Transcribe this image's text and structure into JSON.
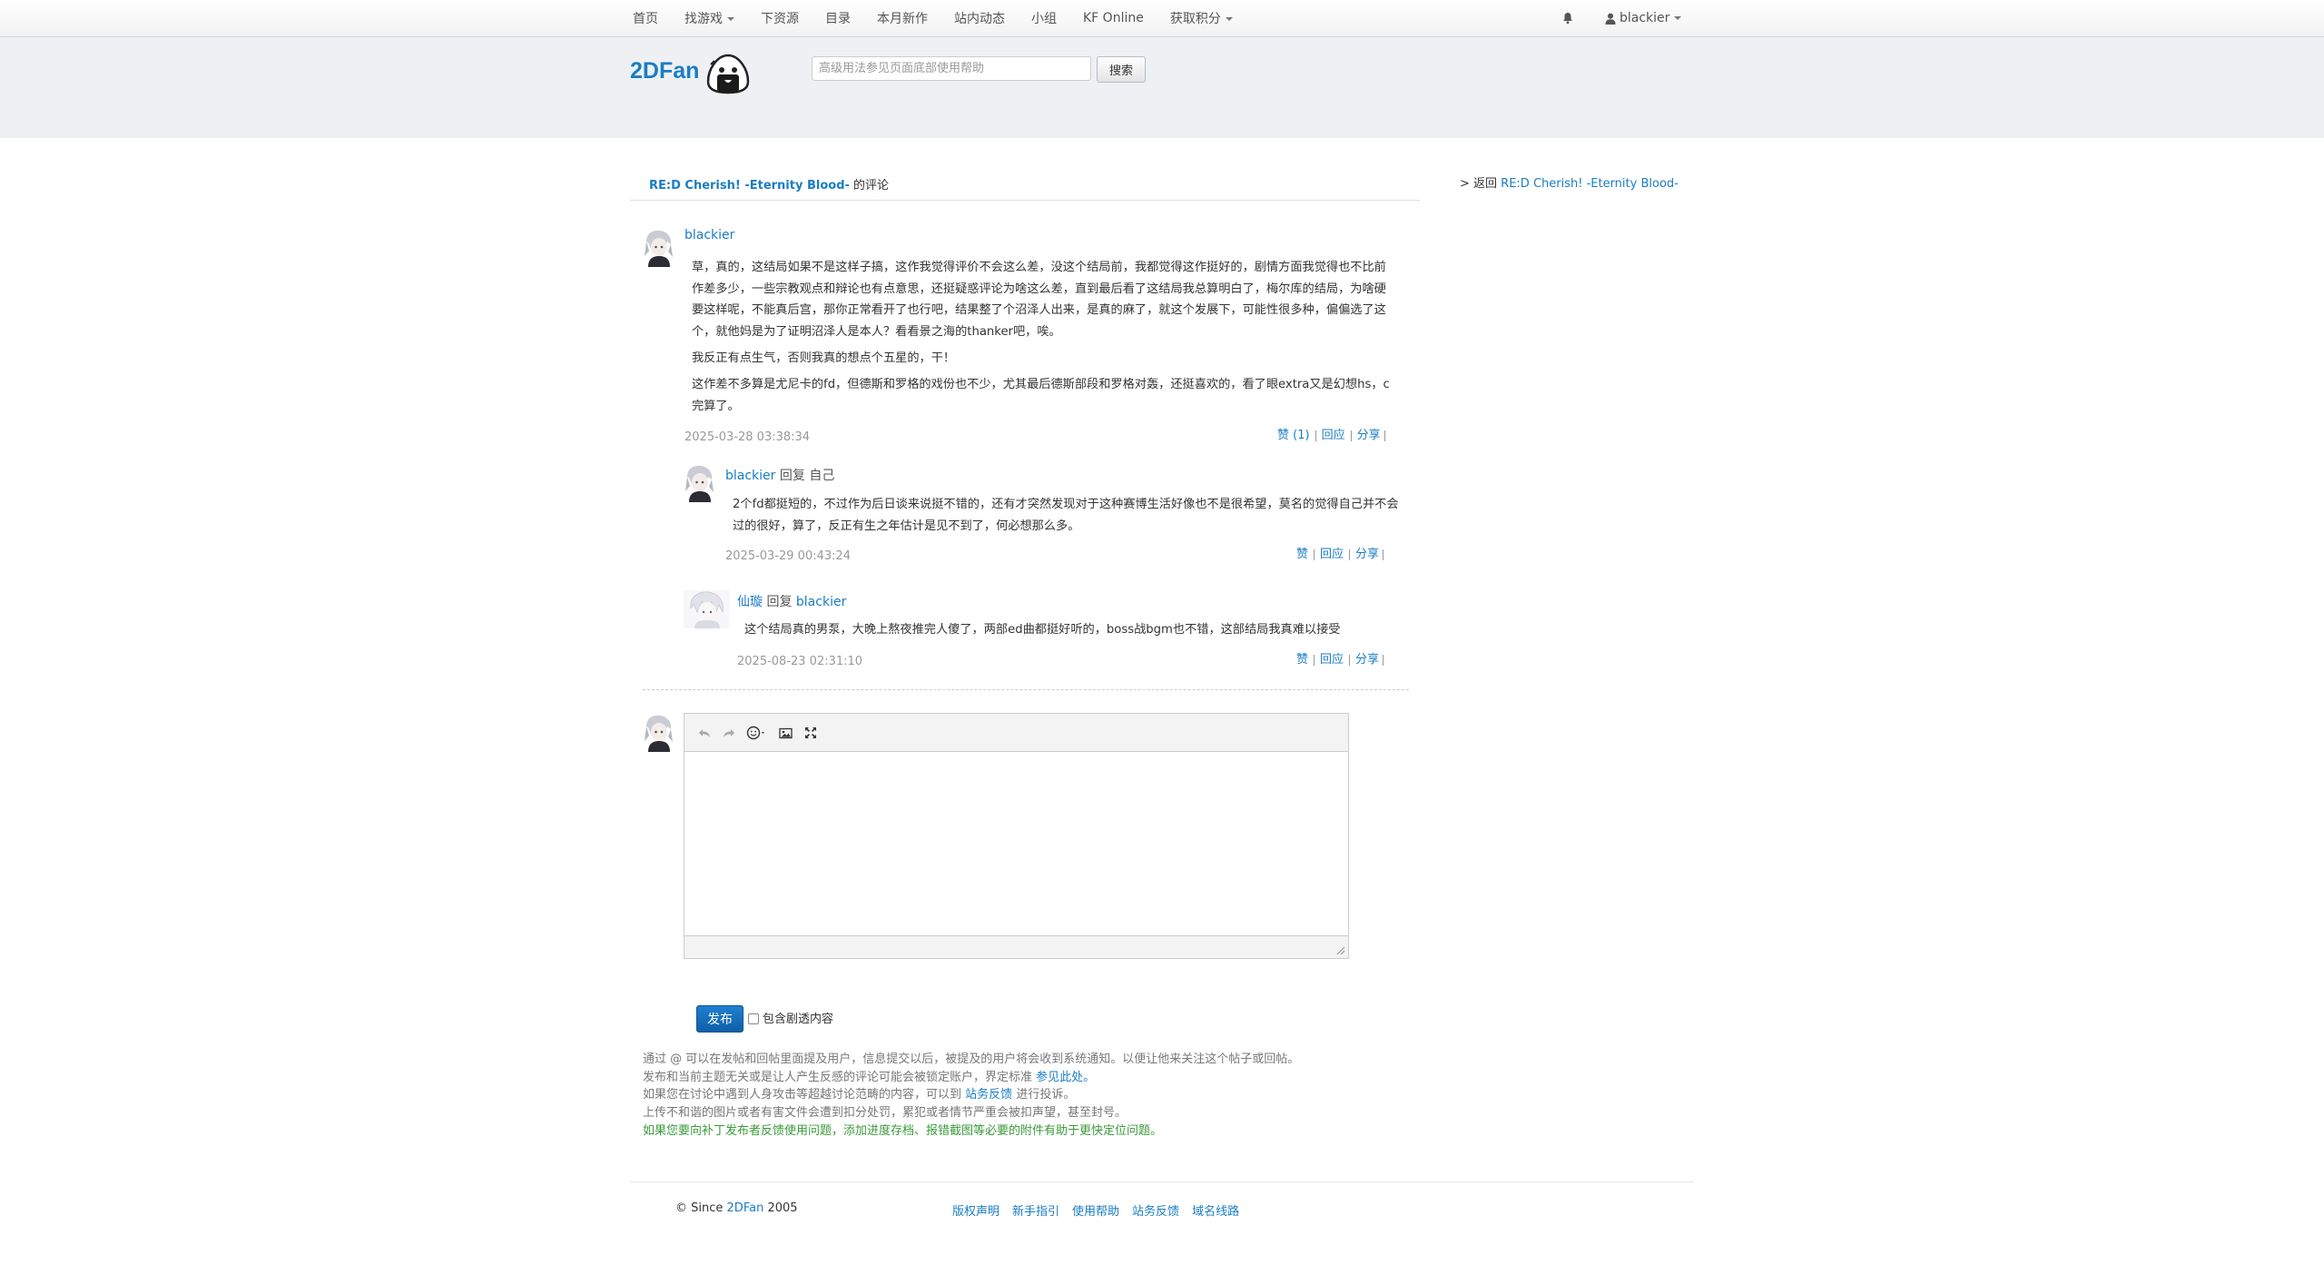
{
  "nav": {
    "items": [
      {
        "label": "首页",
        "dropdown": false
      },
      {
        "label": "找游戏",
        "dropdown": true
      },
      {
        "label": "下资源",
        "dropdown": false
      },
      {
        "label": "目录",
        "dropdown": false
      },
      {
        "label": "本月新作",
        "dropdown": false
      },
      {
        "label": "站内动态",
        "dropdown": false
      },
      {
        "label": "小组",
        "dropdown": false
      },
      {
        "label": "KF Online",
        "dropdown": false
      },
      {
        "label": "获取积分",
        "dropdown": true
      }
    ],
    "user": "blackier"
  },
  "header": {
    "logo": "2DFan",
    "search_placeholder": "高级用法参见页面底部使用帮助",
    "search_button": "搜索"
  },
  "breadcrumb": {
    "title_link": "RE:D Cherish! -Eternity Blood-",
    "suffix": "的评论",
    "back_prefix": "> 返回",
    "back_link": "RE:D Cherish! -Eternity Blood-"
  },
  "main_comment": {
    "author": "blackier",
    "paragraphs": [
      "草，真的，这结局如果不是这样子搞，这作我觉得评价不会这么差，没这个结局前，我都觉得这作挺好的，剧情方面我觉得也不比前作差多少，一些宗教观点和辩论也有点意思，还挺疑惑评论为啥这么差，直到最后看了这结局我总算明白了，梅尔库的结局，为啥硬要这样呢，不能真后宫，那你正常看开了也行吧，结果整了个沼泽人出来，是真的麻了，就这个发展下，可能性很多种，偏偏选了这个，就他妈是为了证明沼泽人是本人？看看景之海的thanker吧，唉。",
      "我反正有点生气，否则我真的想点个五星的，干！",
      "这作差不多算是尤尼卡的fd，但德斯和罗格的戏份也不少，尤其最后德斯部段和罗格对轰，还挺喜欢的，看了眼extra又是幻想hs，c完算了。"
    ],
    "time": "2025-03-28 03:38:34",
    "actions": [
      "赞 (1)",
      "回应",
      "分享"
    ]
  },
  "replies": [
    {
      "author": "blackier",
      "reply_word": "回复",
      "target": "自己",
      "text": "2个fd都挺短的，不过作为后日谈来说挺不错的，还有才突然发现对于这种赛博生活好像也不是很希望，莫名的觉得自己并不会过的很好，算了，反正有生之年估计是见不到了，何必想那么多。",
      "time": "2025-03-29 00:43:24",
      "actions": [
        "赞",
        "回应",
        "分享"
      ]
    },
    {
      "author": "仙璇",
      "reply_word": "回复",
      "target": "blackier",
      "text": "这个结局真的男泵，大晚上熬夜推完人傻了，两部ed曲都挺好听的，boss战bgm也不错，这部结局我真难以接受",
      "time": "2025-08-23 02:31:10",
      "actions": [
        "赞",
        "回应",
        "分享"
      ]
    }
  ],
  "editor": {
    "toolbar": [
      "undo-icon",
      "redo-icon",
      "emoji-icon",
      "image-icon",
      "fullscreen-icon"
    ],
    "content": ""
  },
  "form": {
    "publish": "发布",
    "spoiler_label": "包含剧透内容",
    "spoiler_checked": false
  },
  "notes": {
    "line1": "通过 @ 可以在发帖和回帖里面提及用户，信息提交以后，被提及的用户将会收到系统通知。以便让他来关注这个帖子或回帖。",
    "line2_pre": "发布和当前主题无关或是让人产生反感的评论可能会被锁定账户，界定标准",
    "line2_link": "参见此处。",
    "line3_pre": "如果您在讨论中遇到人身攻击等超越讨论范畴的内容，可以到",
    "line3_link": "站务反馈",
    "line3_post": "进行投诉。",
    "line4": "上传不和谐的图片或者有害文件会遭到扣分处罚，累犯或者情节严重会被扣声望，甚至封号。",
    "line5": "如果您要向补丁发布者反馈使用问题，添加进度存档、报错截图等必要的附件有助于更快定位问题。"
  },
  "footer": {
    "copyright_pre": "© Since",
    "copyright_link": "2DFan",
    "copyright_post": "2005",
    "links": [
      "版权声明",
      "新手指引",
      "使用帮助",
      "站务反馈",
      "域名线路"
    ]
  },
  "colors": {
    "link": "#1a7dc4",
    "publish": "#1467b5",
    "note_green": "#3a9a3a",
    "header_band": "#eef0f4"
  }
}
